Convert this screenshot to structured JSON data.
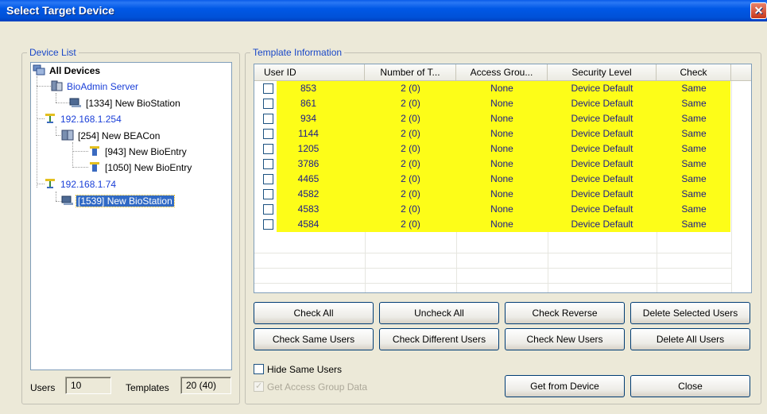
{
  "window": {
    "title": "Select Target Device",
    "close_glyph": "✕"
  },
  "device_list": {
    "legend": "Device List",
    "nodes": [
      {
        "label": "All Devices",
        "icon": "all-devices-icon",
        "bold": true
      },
      {
        "label": "BioAdmin Server",
        "icon": "server-icon",
        "blue": true
      },
      {
        "label": "[1334] New BioStation",
        "icon": "biostation-icon"
      },
      {
        "label": "192.168.1.254",
        "icon": "network-icon",
        "blue": true
      },
      {
        "label": "[254] New BEACon",
        "icon": "beacon-icon"
      },
      {
        "label": "[943] New BioEntry",
        "icon": "bioentry-icon"
      },
      {
        "label": "[1050] New BioEntry",
        "icon": "bioentry-icon"
      },
      {
        "label": "192.168.1.74",
        "icon": "network-icon",
        "blue": true
      },
      {
        "label": "[1539] New BioStation",
        "icon": "biostation-icon",
        "selected": true
      }
    ],
    "users_label": "Users",
    "users_value": "10",
    "templates_label": "Templates",
    "templates_value": "20 (40)"
  },
  "template_info": {
    "legend": "Template Information",
    "columns": [
      "User ID",
      "Number of T...",
      "Access Grou...",
      "Security Level",
      "Check"
    ],
    "rows": [
      {
        "user_id": "853",
        "num": "2 (0)",
        "access": "None",
        "security": "Device Default",
        "check": "Same"
      },
      {
        "user_id": "861",
        "num": "2 (0)",
        "access": "None",
        "security": "Device Default",
        "check": "Same"
      },
      {
        "user_id": "934",
        "num": "2 (0)",
        "access": "None",
        "security": "Device Default",
        "check": "Same"
      },
      {
        "user_id": "1144",
        "num": "2 (0)",
        "access": "None",
        "security": "Device Default",
        "check": "Same"
      },
      {
        "user_id": "1205",
        "num": "2 (0)",
        "access": "None",
        "security": "Device Default",
        "check": "Same"
      },
      {
        "user_id": "3786",
        "num": "2 (0)",
        "access": "None",
        "security": "Device Default",
        "check": "Same"
      },
      {
        "user_id": "4465",
        "num": "2 (0)",
        "access": "None",
        "security": "Device Default",
        "check": "Same"
      },
      {
        "user_id": "4582",
        "num": "2 (0)",
        "access": "None",
        "security": "Device Default",
        "check": "Same"
      },
      {
        "user_id": "4583",
        "num": "2 (0)",
        "access": "None",
        "security": "Device Default",
        "check": "Same"
      },
      {
        "user_id": "4584",
        "num": "2 (0)",
        "access": "None",
        "security": "Device Default",
        "check": "Same"
      }
    ],
    "highlight_color": "#fdfd18"
  },
  "buttons": {
    "check_all": "Check All",
    "uncheck_all": "Uncheck All",
    "check_reverse": "Check Reverse",
    "delete_selected": "Delete Selected Users",
    "check_same": "Check Same Users",
    "check_different": "Check Different Users",
    "check_new": "Check New Users",
    "delete_all": "Delete All Users",
    "get_from_device": "Get from Device",
    "close": "Close"
  },
  "options": {
    "hide_same_users": "Hide Same Users",
    "get_access_group_data": "Get Access Group Data"
  }
}
